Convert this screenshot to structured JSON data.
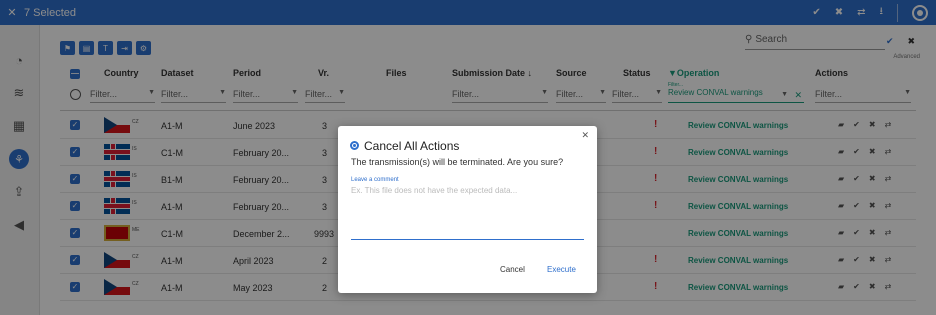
{
  "selection": {
    "label": "7 Selected"
  },
  "toolbar": {
    "advanced": "Advanced"
  },
  "search": {
    "placeholder": "Search"
  },
  "columns": {
    "country": "Country",
    "dataset": "Dataset",
    "period": "Period",
    "vr": "Vr.",
    "files": "Files",
    "submission_date": "Submission Date",
    "source": "Source",
    "status": "Status",
    "operation": "Operation",
    "actions": "Actions"
  },
  "filters": {
    "placeholder": "Filter...",
    "operation_label": "Filter...",
    "operation_value": "Review CONVAL warnings"
  },
  "rows": [
    {
      "code": "CZ",
      "dataset": "A1-M",
      "period": "June 2023",
      "vr": "3",
      "operation": "Review CONVAL warnings"
    },
    {
      "code": "IS",
      "dataset": "C1-M",
      "period": "February 20...",
      "vr": "3",
      "operation": "Review CONVAL warnings"
    },
    {
      "code": "IS",
      "dataset": "B1-M",
      "period": "February 20...",
      "vr": "3",
      "operation": "Review CONVAL warnings"
    },
    {
      "code": "IS",
      "dataset": "A1-M",
      "period": "February 20...",
      "vr": "3",
      "operation": "Review CONVAL warnings"
    },
    {
      "code": "ME",
      "dataset": "C1-M",
      "period": "December 2...",
      "vr": "9993",
      "operation": "Review CONVAL warnings"
    },
    {
      "code": "CZ",
      "dataset": "A1-M",
      "period": "April 2023",
      "vr": "2",
      "operation": "Review CONVAL warnings"
    },
    {
      "code": "CZ",
      "dataset": "A1-M",
      "period": "May 2023",
      "vr": "2",
      "operation": "Review CONVAL warnings"
    }
  ],
  "dialog": {
    "title": "Cancel All Actions",
    "message": "The transmission(s) will be terminated. Are you sure?",
    "comment_label": "Leave a comment",
    "comment_placeholder": "Ex. This file does not have the expected data...",
    "cancel": "Cancel",
    "execute": "Execute"
  }
}
